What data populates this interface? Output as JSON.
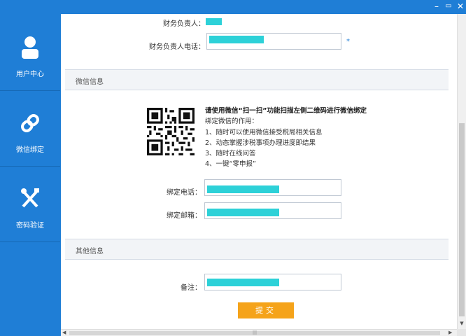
{
  "window": {
    "minimize_glyph": "–",
    "maximize_glyph": "▭",
    "close_glyph": "✕"
  },
  "sidebar": {
    "items": [
      {
        "label": "用户中心",
        "icon": "user-icon"
      },
      {
        "label": "微信绑定",
        "icon": "link-icon"
      },
      {
        "label": "密码验证",
        "icon": "tools-icon"
      }
    ]
  },
  "finance": {
    "manager_label": "财务负责人：",
    "phone_label": "财务负责人电话：",
    "required_mark": "*"
  },
  "wechat": {
    "section_title": "微信信息",
    "instruction_title": "请使用微信“扫一扫”功能扫描左侧二维码进行微信绑定",
    "purpose_title": "绑定微信的作用：",
    "purposes": [
      "1、随时可以使用微信接受税局相关信息",
      "2、动态掌握涉税事项办理进度即结果",
      "3、随时在线问答",
      "4、一键“零申报”"
    ],
    "bind_phone_label": "绑定电话：",
    "bind_email_label": "绑定邮箱："
  },
  "other": {
    "section_title": "其他信息",
    "remark_label": "备注："
  },
  "submit_label": "提交",
  "colors": {
    "accent": "#1f7ed6",
    "redacted": "#2dd1d8",
    "submit": "#f5a31a"
  }
}
